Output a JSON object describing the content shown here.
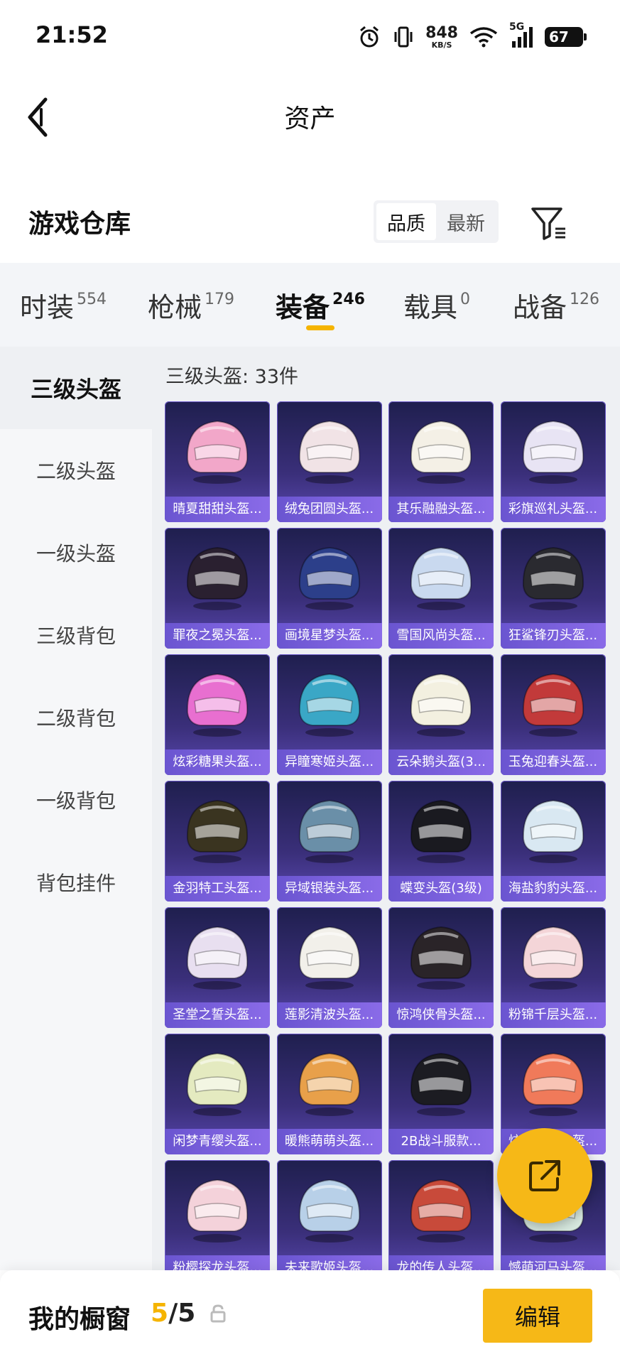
{
  "status_bar": {
    "time": "21:52",
    "net_speed": "848",
    "net_unit": "KB/S",
    "network": "5G",
    "battery": "67",
    "icons": [
      "alarm-icon",
      "vibrate-icon",
      "wifi-icon",
      "signal-icon",
      "battery-icon"
    ]
  },
  "header": {
    "title": "资产",
    "back_icon": "chevron-left-icon"
  },
  "warehouse": {
    "title": "游戏仓库",
    "sort_options": [
      "品质",
      "最新"
    ],
    "sort_active": "品质",
    "filter_icon": "filter-list-icon"
  },
  "tabs": [
    {
      "label": "时装",
      "count": "554"
    },
    {
      "label": "枪械",
      "count": "179"
    },
    {
      "label": "装备",
      "count": "246"
    },
    {
      "label": "载具",
      "count": "0"
    },
    {
      "label": "战备",
      "count": "126"
    }
  ],
  "active_tab": "装备",
  "categories": [
    {
      "label": "三级头盔"
    },
    {
      "label": "二级头盔"
    },
    {
      "label": "一级头盔"
    },
    {
      "label": "三级背包"
    },
    {
      "label": "二级背包"
    },
    {
      "label": "一级背包"
    },
    {
      "label": "背包挂件"
    }
  ],
  "active_category": "三级头盔",
  "section": {
    "title": "三级头盔: 33件"
  },
  "items": [
    {
      "name": "晴夏甜甜头盔...",
      "color": "#f2a7c9"
    },
    {
      "name": "绒兔团圆头盔...",
      "color": "#f1e3e6"
    },
    {
      "name": "其乐融融头盔...",
      "color": "#f4f0e6"
    },
    {
      "name": "彩旗巡礼头盔...",
      "color": "#e8e4f4"
    },
    {
      "name": "罪夜之冕头盔...",
      "color": "#2a2030"
    },
    {
      "name": "画境星梦头盔...",
      "color": "#2c3f8a"
    },
    {
      "name": "雪国风尚头盔...",
      "color": "#c9d9ef"
    },
    {
      "name": "狂鲨锋刃头盔...",
      "color": "#2a2a30"
    },
    {
      "name": "炫彩糖果头盔...",
      "color": "#e86fd0"
    },
    {
      "name": "异瞳寒姬头盔...",
      "color": "#3aa7c6"
    },
    {
      "name": "云朵鹅头盔(3...",
      "color": "#f3f0e0"
    },
    {
      "name": "玉兔迎春头盔...",
      "color": "#c23a3a"
    },
    {
      "name": "金羽特工头盔...",
      "color": "#3a3420"
    },
    {
      "name": "异域银装头盔...",
      "color": "#6a8fa8"
    },
    {
      "name": "蝶变头盔(3级)",
      "color": "#1a1a20"
    },
    {
      "name": "海盐豹豹头盔...",
      "color": "#d9e8f2"
    },
    {
      "name": "圣堂之誓头盔...",
      "color": "#e8dff0"
    },
    {
      "name": "莲影清波头盔...",
      "color": "#f2f0ea"
    },
    {
      "name": "惊鸿侠骨头盔...",
      "color": "#2a2428"
    },
    {
      "name": "粉锦千层头盔...",
      "color": "#f4d5d8"
    },
    {
      "name": "闲梦青缨头盔...",
      "color": "#e4eac0"
    },
    {
      "name": "暖熊萌萌头盔...",
      "color": "#e8a04a"
    },
    {
      "name": "2B战斗服款...",
      "color": "#1c1c22"
    },
    {
      "name": "炫彩糖果头盔...",
      "color": "#f07a5a"
    },
    {
      "name": "粉樱探龙头盔...",
      "color": "#f4d2da"
    },
    {
      "name": "未来歌姬头盔...",
      "color": "#b8d0e8"
    },
    {
      "name": "龙的传人头盔...",
      "color": "#c84a3a"
    },
    {
      "name": "憾萌河马头盔...",
      "color": "#d8eae0"
    }
  ],
  "bottom_bar": {
    "showcase_label": "我的橱窗",
    "current": "5",
    "separator": "/",
    "total": "5",
    "edit_label": "编辑"
  },
  "colors": {
    "accent": "#f6b817",
    "card_bg": "#3a2f7a",
    "card_label": "#7a60e0"
  }
}
